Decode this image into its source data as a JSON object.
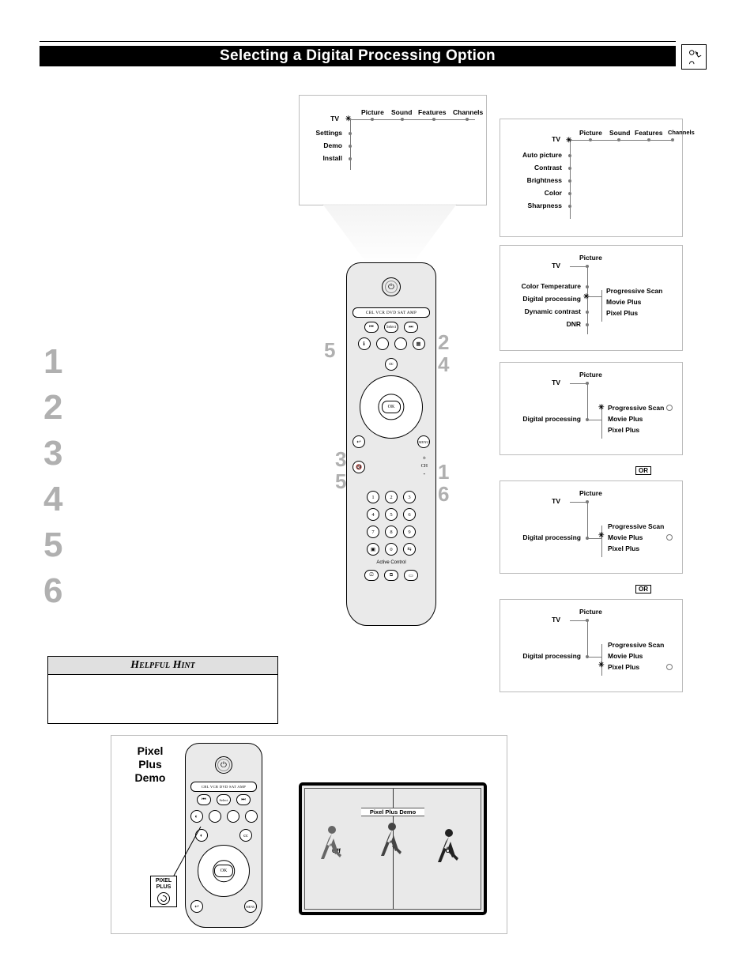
{
  "title": "Selecting a Digital Processing Option",
  "topright_icon": "remote-person-icon",
  "steps": [
    "1",
    "2",
    "3",
    "4",
    "5",
    "6"
  ],
  "hint_header": "Helpful Hint",
  "menu1": {
    "root": "TV",
    "across": [
      "Picture",
      "Sound",
      "Features",
      "Channels"
    ],
    "down": [
      "Settings",
      "Demo",
      "Install"
    ]
  },
  "menu2": {
    "root": "TV",
    "across": [
      "Picture",
      "Sound",
      "Features",
      "Channels"
    ],
    "down": [
      "Auto picture",
      "Contrast",
      "Brightness",
      "Color",
      "Sharpness"
    ]
  },
  "menu3": {
    "root": "TV",
    "heading": "Picture",
    "down": [
      "Color Temperature",
      "Digital processing",
      "Dynamic contrast",
      "DNR"
    ],
    "branch_from": "Digital processing",
    "branch": [
      "Progressive Scan",
      "Movie Plus",
      "Pixel Plus"
    ]
  },
  "menu4": {
    "root": "TV",
    "heading": "Picture",
    "down": [
      "Digital processing"
    ],
    "branch": [
      "Progressive Scan",
      "Movie Plus",
      "Pixel Plus"
    ],
    "selected": "Progressive Scan"
  },
  "menu5": {
    "root": "TV",
    "heading": "Picture",
    "down": [
      "Digital processing"
    ],
    "branch": [
      "Progressive Scan",
      "Movie Plus",
      "Pixel Plus"
    ],
    "selected": "Movie Plus"
  },
  "menu6": {
    "root": "TV",
    "heading": "Picture",
    "down": [
      "Digital processing"
    ],
    "branch": [
      "Progressive Scan",
      "Movie Plus",
      "Pixel Plus"
    ],
    "selected": "Pixel Plus"
  },
  "or_label": "OR",
  "remote": {
    "devices": "CBL  VCR  DVD  SAT  AMP",
    "row_icons": [
      "⏮",
      "Select",
      "⏭"
    ],
    "ok": "OK",
    "menu": "MENU",
    "ch_plus": "+",
    "ch_label": "CH",
    "ch_minus": "-",
    "mute": "🔇",
    "nums": [
      "1",
      "2",
      "3",
      "4",
      "5",
      "6",
      "7",
      "8",
      "9",
      "0"
    ],
    "ac_label": "Active Control",
    "bottom": [
      "⎚",
      "⧉",
      "▭"
    ]
  },
  "callouts": {
    "c1": "1",
    "c2": "2",
    "c3": "3",
    "c4": "4",
    "c5a": "5",
    "c5b": "5",
    "c6": "6"
  },
  "demo": {
    "title_l1": "Pixel",
    "title_l2": "Plus",
    "title_l3": "Demo",
    "tv_title": "Pixel Plus Demo",
    "off": "Off",
    "on": "On"
  },
  "pp_chip": {
    "l1": "PIXEL",
    "l2": "PLUS"
  }
}
